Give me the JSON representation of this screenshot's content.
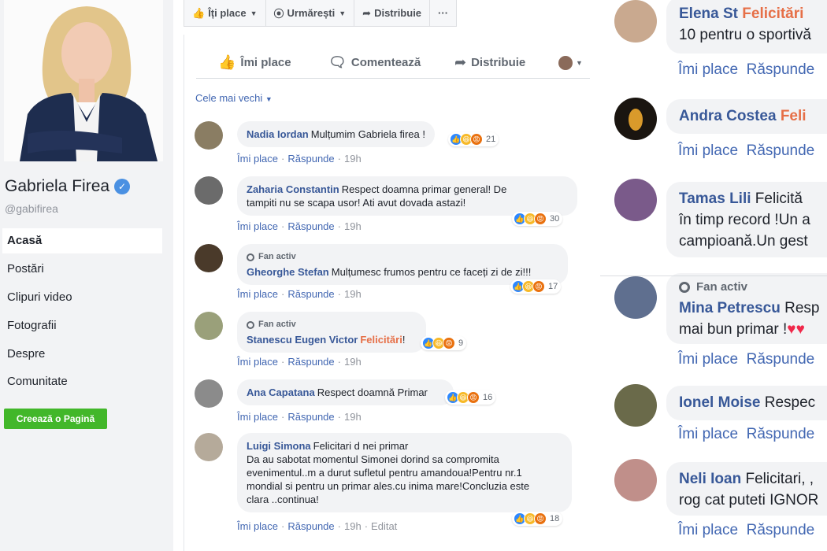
{
  "profile": {
    "name": "Gabriela Firea",
    "handle": "@gabifirea"
  },
  "nav": [
    {
      "label": "Acasă"
    },
    {
      "label": "Postări"
    },
    {
      "label": "Clipuri video"
    },
    {
      "label": "Fotografii"
    },
    {
      "label": "Despre"
    },
    {
      "label": "Comunitate"
    }
  ],
  "create_page_label": "Creează o Pagină",
  "page_actions": {
    "like": "Îți place",
    "follow": "Urmărești",
    "share": "Distribuie",
    "more": "···"
  },
  "post_actions": {
    "like": "Îmi place",
    "comment": "Comentează",
    "share": "Distribuie"
  },
  "sort_label": "Cele mai vechi",
  "meta_labels": {
    "like": "Îmi place",
    "reply": "Răspunde",
    "edited": "Editat",
    "fan": "Fan activ"
  },
  "comments": [
    {
      "name": "Nadia Iordan",
      "text": "Mulțumim Gabriela firea !",
      "count": "21",
      "time": "19h"
    },
    {
      "name": "Zaharia Constantin",
      "text": "Respect doamna primar general! De",
      "text2": "tampiti nu se scapa usor! Ati avut dovada astazi!",
      "count": "30",
      "time": "19h"
    },
    {
      "name": "Gheorghe Stefan",
      "text": "Mulțumesc frumos pentru ce faceți zi de zi!!!",
      "count": "17",
      "time": "19h"
    },
    {
      "name": "Stanescu Eugen Victor",
      "highlight": "Felicitări",
      "text": "!",
      "count": "9",
      "time": "19h"
    },
    {
      "name": "Ana Capatana",
      "text": "Respect doamnă Primar",
      "count": "16",
      "time": "19h"
    },
    {
      "name": "Luigi Simona",
      "text": "Felicitari d nei primar",
      "text2": "Da au sabotat momentul Simonei dorind sa compromita",
      "text3": "evenimentul..m a durut sufletul pentru amandoua!Pentru nr.1",
      "text4": "mondial si pentru un primar ales.cu inima mare!Concluzia este",
      "text5": "clara ..continua!",
      "count": "18",
      "time": "19h"
    }
  ],
  "right_comments": [
    {
      "name": "Elena St",
      "highlight": "Felicitări",
      "line2": "10 pentru o sportivă"
    },
    {
      "name": "Andra Costea",
      "highlight": "Feli"
    },
    {
      "name": "Tamas Lili",
      "text": "Felicită",
      "line2": "în timp record !Un a",
      "line3": "campioană.Un gest"
    },
    {
      "name": "Mina Petrescu",
      "text": "Resp",
      "line2": "mai bun primar !"
    },
    {
      "name": "Ionel Moise",
      "text": "Respec"
    },
    {
      "name": "Neli Ioan",
      "text": "Felicitari, ,",
      "line2": "rog cat puteti IGNOR"
    }
  ],
  "colors": {
    "link": "#385898",
    "highlight": "#e66f47",
    "green_button": "#42b72a",
    "sidebar_bg": "#f2f3f5"
  }
}
